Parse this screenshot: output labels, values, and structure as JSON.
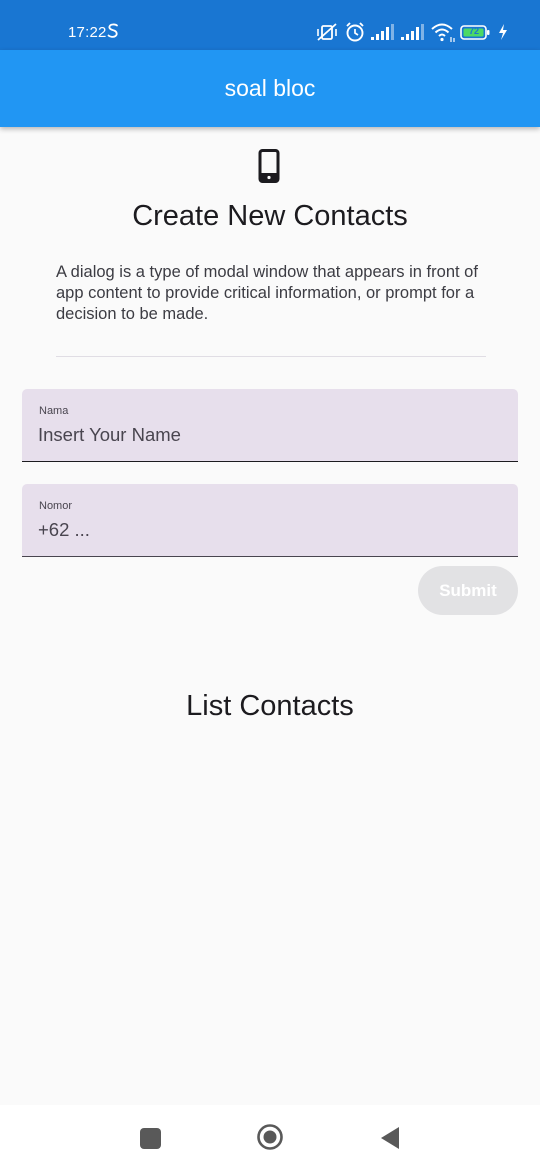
{
  "status_bar": {
    "time": "17:22",
    "battery_level": "72",
    "icons": [
      "s-icon",
      "mute-vibrate-icon",
      "alarm-icon",
      "signal-icon",
      "signal-icon",
      "wifi-icon",
      "battery-icon",
      "charging-icon"
    ]
  },
  "app_bar": {
    "title": "soal bloc",
    "color": "#2196f3"
  },
  "header": {
    "icon": "smartphone-icon",
    "title": "Create New Contacts",
    "description": "A dialog is a type of modal window that appears in front of app content to provide critical information, or prompt for a decision to be made."
  },
  "form": {
    "name": {
      "label": "Nama",
      "value": "",
      "placeholder": "Insert Your Name"
    },
    "number": {
      "label": "Nomor",
      "value": "",
      "placeholder": "+62 ..."
    },
    "submit_label": "Submit"
  },
  "contacts": {
    "title": "List Contacts",
    "items": []
  },
  "nav_bar": {
    "icons": [
      "recent-apps-icon",
      "home-icon",
      "back-icon"
    ]
  }
}
